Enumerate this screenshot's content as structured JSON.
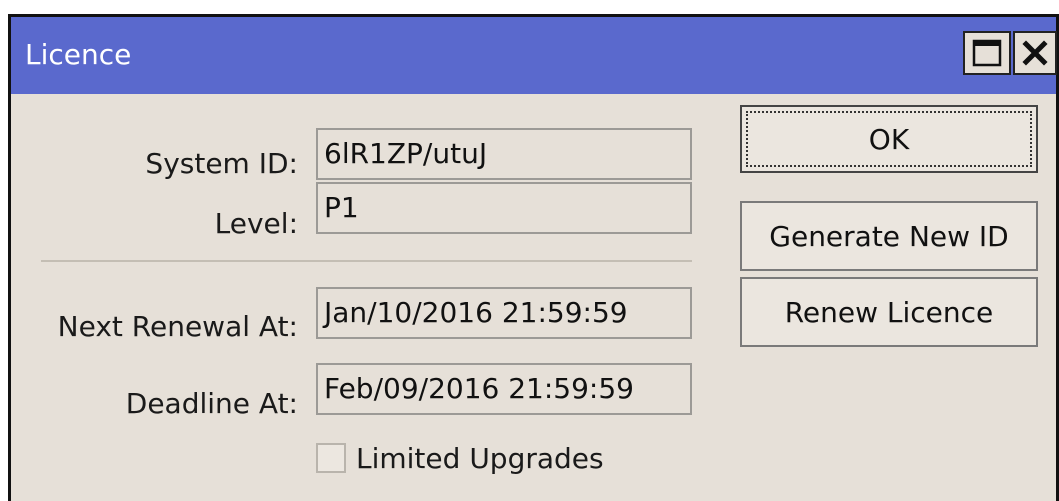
{
  "window": {
    "title": "Licence"
  },
  "form": {
    "system_id_label": "System ID:",
    "system_id_value": "6lR1ZP/utuJ",
    "level_label": "Level:",
    "level_value": "P1",
    "next_renewal_label": "Next Renewal At:",
    "next_renewal_value": "Jan/10/2016 21:59:59",
    "deadline_label": "Deadline At:",
    "deadline_value": "Feb/09/2016 21:59:59",
    "limited_upgrades_label": "Limited Upgrades",
    "limited_upgrades_checked": false
  },
  "buttons": {
    "ok": "OK",
    "generate_new_id": "Generate New ID",
    "renew_licence": "Renew Licence"
  },
  "icons": {
    "maximize": "maximize-icon",
    "close": "close-icon"
  },
  "colors": {
    "titlebar": "#5a69cd",
    "window_bg": "#e6e0d8"
  }
}
